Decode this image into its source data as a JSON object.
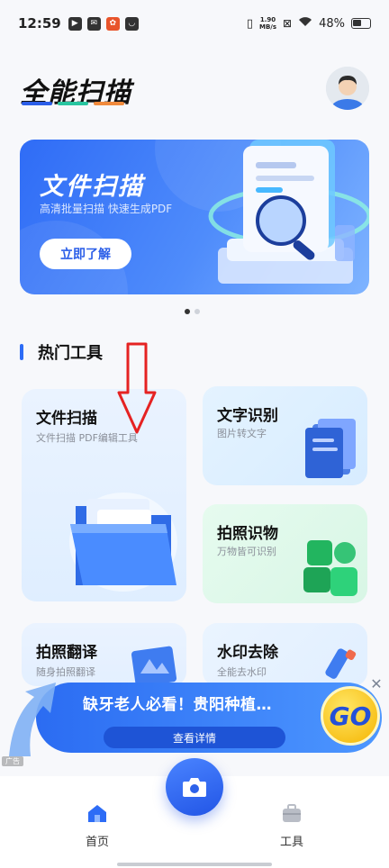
{
  "status_bar": {
    "time": "12:59",
    "net_speed_value": "1.90",
    "net_speed_unit": "MB/s",
    "battery": "48%"
  },
  "app": {
    "logo": "全能扫描",
    "logo_bar_colors": [
      "#2b5ee8",
      "#29c5a0",
      "#f08a3c"
    ]
  },
  "banner": {
    "title": "文件扫描",
    "subtitle": "高清批量扫描 快速生成PDF",
    "button": "立即了解",
    "page_index": 0,
    "page_count": 2
  },
  "section": {
    "title": "热门工具"
  },
  "tools": [
    {
      "title": "文件扫描",
      "subtitle": "文件扫描 PDF编辑工具",
      "icon": "folder-icon"
    },
    {
      "title": "文字识别",
      "subtitle": "图片转文字",
      "icon": "document-stack-icon"
    },
    {
      "title": "拍照识物",
      "subtitle": "万物皆可识别",
      "icon": "blocks-icon"
    },
    {
      "title": "拍照翻译",
      "subtitle": "随身拍照翻译",
      "icon": "translate-icon"
    },
    {
      "title": "水印去除",
      "subtitle": "全能去水印",
      "icon": "eraser-icon"
    }
  ],
  "ad": {
    "text": "缺牙老人必看！贵阳种植…",
    "button": "查看详情",
    "go_label": "GO",
    "tag": "广告"
  },
  "nav": {
    "home": "首页",
    "tools": "工具"
  },
  "colors": {
    "accent": "#2d6cf6",
    "red_arrow": "#e52222"
  }
}
